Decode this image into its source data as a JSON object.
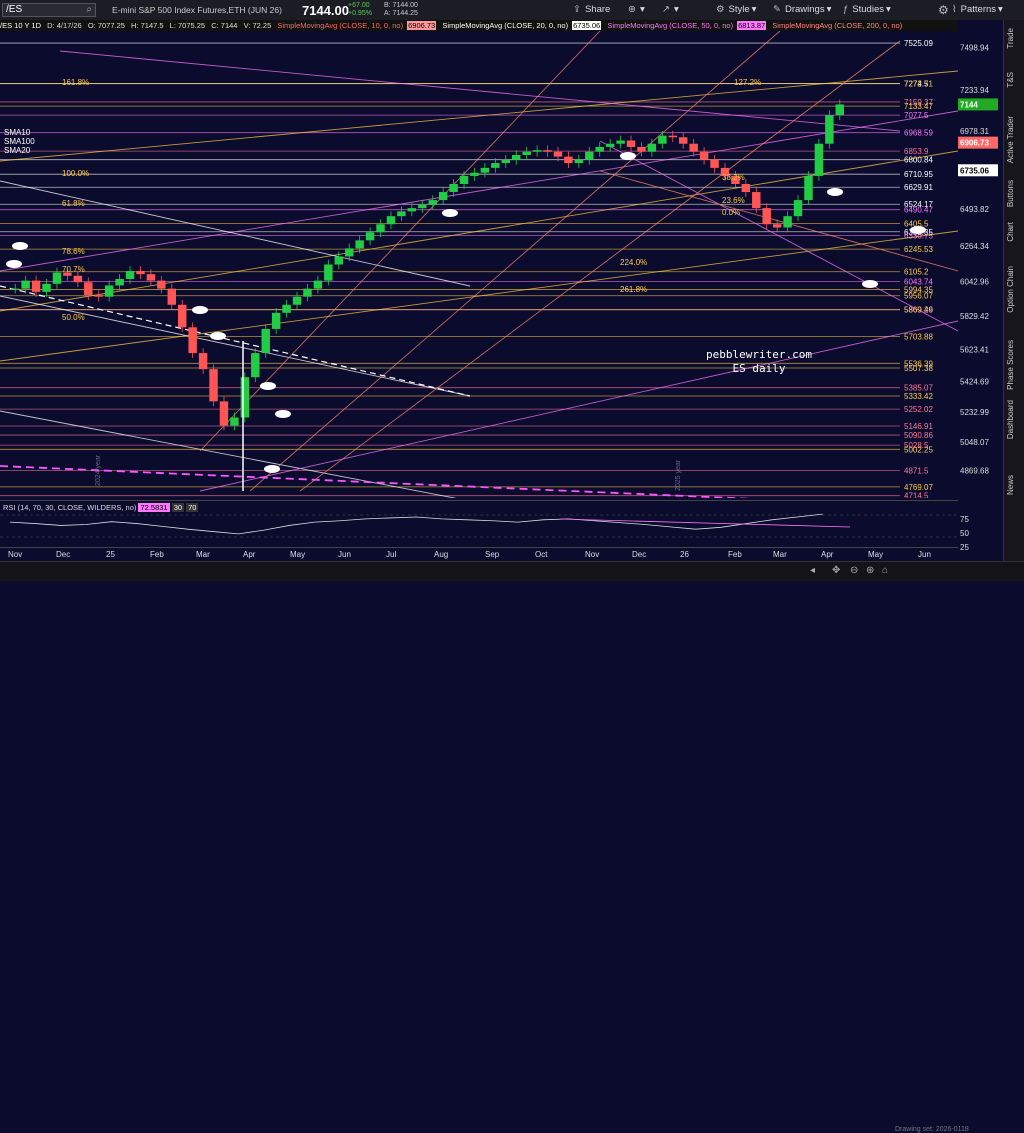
{
  "topbar": {
    "symbol": "/ES",
    "description": "E-mini S&P 500 Index Futures,ETH (JUN 26)",
    "last_price": "7144.00",
    "change": "+67.00",
    "change_pct": "+0.95%",
    "bid": "B: 7144.00",
    "ask": "A: 7144.25",
    "share": "Share",
    "style": "Style",
    "drawings": "Drawings",
    "studies": "Studies",
    "patterns": "Patterns"
  },
  "infobar": {
    "period": "/ES 10 Y 1D",
    "date": "D: 4/17/26",
    "open": "O: 7077.25",
    "high": "H: 7147.5",
    "low": "L: 7075.25",
    "close": "C: 7144",
    "volume": "V: 72.25",
    "sma10": "SimpleMovingAvg (CLOSE, 10, 0, no)",
    "sma10_val": "6906.73",
    "sma20": "SimpleMovingAvg (CLOSE, 20, 0, no)",
    "sma20_val": "6735.06",
    "sma50": "SimpleMovingAvg (CLOSE, 50, 0, no)",
    "sma50_val": "6813.87",
    "sma200": "SimpleMovingAvg (CLOSE, 200, 0, no)"
  },
  "price_axis": [
    "7498.94",
    "7233.94",
    "6978.31",
    "6735.06",
    "6493.82",
    "6264.34",
    "6042.96",
    "5829.42",
    "5623.41",
    "5424.69",
    "5232.99",
    "5048.07",
    "4869.68"
  ],
  "price_tags": [
    {
      "label": "7144",
      "color": "#22aa22"
    },
    {
      "label": "6906.73",
      "color": "#ff6666"
    },
    {
      "label": "6735.06",
      "color": "#ffffff"
    }
  ],
  "levels": [
    {
      "v": "7525.09",
      "c": "#ffffff"
    },
    {
      "v": "7274.5",
      "c": "#ffffff"
    },
    {
      "v": "7272.71",
      "c": "#ffcc44"
    },
    {
      "v": "7159.37",
      "c": "#ff7799"
    },
    {
      "v": "7133.47",
      "c": "#ffcc44"
    },
    {
      "v": "7077.5",
      "c": "#ff77ff"
    },
    {
      "v": "6968.59",
      "c": "#ff77ff"
    },
    {
      "v": "6853.9",
      "c": "#ff7799"
    },
    {
      "v": "6800.84",
      "c": "#ffffff"
    },
    {
      "v": "6710.95",
      "c": "#ffffff"
    },
    {
      "v": "6629.91",
      "c": "#ffffff"
    },
    {
      "v": "6524.17",
      "c": "#ffffff"
    },
    {
      "v": "6490.47",
      "c": "#ff77ff"
    },
    {
      "v": "6405.5",
      "c": "#ffcc44"
    },
    {
      "v": "6353.35",
      "c": "#ffffff"
    },
    {
      "v": "6330.75",
      "c": "#ff77ff"
    },
    {
      "v": "6245.53",
      "c": "#ffcc44"
    },
    {
      "v": "6105.2",
      "c": "#ffcc44"
    },
    {
      "v": "6043.74",
      "c": "#ff77ff"
    },
    {
      "v": "5994.35",
      "c": "#ffcc44"
    },
    {
      "v": "5956.07",
      "c": "#ffcc44"
    },
    {
      "v": "5869.29",
      "c": "#ff77ff"
    },
    {
      "v": "5869.46",
      "c": "#ffcc44"
    },
    {
      "v": "5703.88",
      "c": "#ffcc44"
    },
    {
      "v": "5536.39",
      "c": "#ffcc44"
    },
    {
      "v": "5507.38",
      "c": "#ffcc44"
    },
    {
      "v": "5385.07",
      "c": "#ff7799"
    },
    {
      "v": "5333.42",
      "c": "#ffcc44"
    },
    {
      "v": "5252.02",
      "c": "#ff7799"
    },
    {
      "v": "5146.91",
      "c": "#ff7799"
    },
    {
      "v": "5090.86",
      "c": "#ff7799"
    },
    {
      "v": "5028.5",
      "c": "#ff7799"
    },
    {
      "v": "5002.25",
      "c": "#ffcc44"
    },
    {
      "v": "4871.5",
      "c": "#ff7799"
    },
    {
      "v": "4769.07",
      "c": "#ffcc44"
    },
    {
      "v": "4714.5",
      "c": "#ff7799"
    }
  ],
  "fib_labels": [
    "161.8%",
    "127.2%",
    "100.0%",
    "61.8%",
    "38.2%",
    "23.6%",
    "0.0%",
    "224.0%",
    "261.8%",
    "78.6%",
    "70.7%",
    "50.0%"
  ],
  "ma_labels": [
    "SMA10",
    "SMA100",
    "SMA20"
  ],
  "watermark": {
    "line1": "pebblewriter.com",
    "line2": "ES daily"
  },
  "year_labels": [
    "2024 year",
    "2025 year"
  ],
  "rsi": {
    "label": "RSI (14, 70, 30, CLOSE, WILDERS, no)",
    "value": "72.5831",
    "ob": "30",
    "os": "70",
    "ticks": [
      "75",
      "50",
      "25"
    ]
  },
  "x_axis": [
    "Nov",
    "Dec",
    "25",
    "Feb",
    "Mar",
    "Apr",
    "May",
    "Jun",
    "Jul",
    "Aug",
    "Sep",
    "Oct",
    "Nov",
    "Dec",
    "26",
    "Feb",
    "Mar",
    "Apr",
    "May",
    "Jun"
  ],
  "sidebar": [
    "Trade",
    "T&S",
    "Active Trader",
    "Buttons",
    "Chart",
    "Option Chain",
    "Phase Scores",
    "Dashboard",
    "News"
  ],
  "status": "Drawing set: 2026-0118"
}
